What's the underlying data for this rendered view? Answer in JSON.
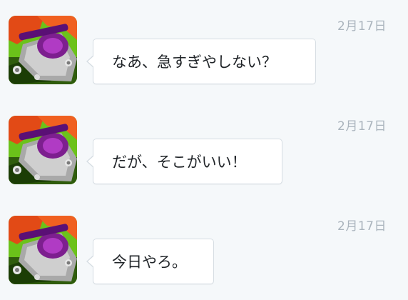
{
  "messages": [
    {
      "text": "なあ、急すぎやしない？",
      "date": "2月17日"
    },
    {
      "text": "だが、そこがいい！",
      "date": "2月17日"
    },
    {
      "text": "今日やろ。",
      "date": "2月17日"
    }
  ],
  "avatar": {
    "icon": "robot-avatar-icon"
  },
  "colors": {
    "background": "#f5f8fa",
    "bubble": "#ffffff",
    "bubble_border": "#d6dde3",
    "date": "#aab4bd",
    "text": "#1f2327"
  }
}
